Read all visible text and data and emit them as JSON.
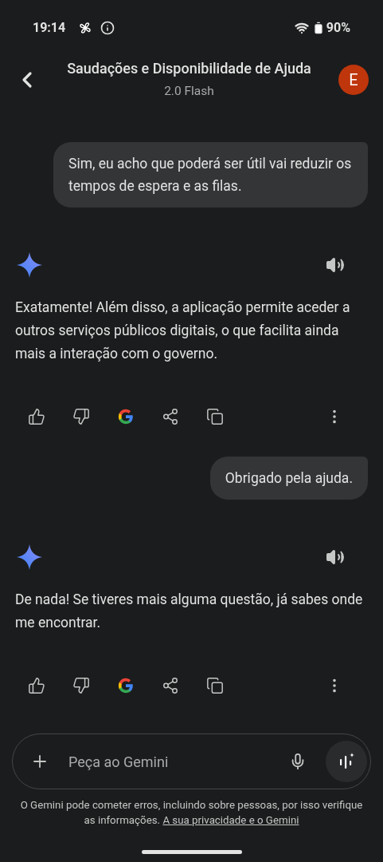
{
  "status_bar": {
    "time": "19:14",
    "battery": "90%"
  },
  "header": {
    "title": "Saudações e Disponibilidade de Ajuda",
    "subtitle": "2.0 Flash",
    "avatar": "E"
  },
  "messages": [
    {
      "kind": "user",
      "text": "Sim, eu acho que poderá ser útil vai reduzir os tempos de espera e as filas."
    },
    {
      "kind": "model",
      "text": "Exatamente! Além disso, a aplicação permite aceder a outros serviços públicos digitais, o que facilita ainda mais a interação com o governo."
    },
    {
      "kind": "user",
      "text": "Obrigado pela ajuda."
    },
    {
      "kind": "model",
      "text": "De nada! Se tiveres mais alguma questão, já sabes onde me encontrar."
    }
  ],
  "input": {
    "placeholder": "Peça ao Gemini"
  },
  "disclaimer": {
    "text": "O Gemini pode cometer erros, incluindo sobre pessoas, por isso verifique as informações.",
    "link": "A sua privacidade e o Gemini"
  }
}
